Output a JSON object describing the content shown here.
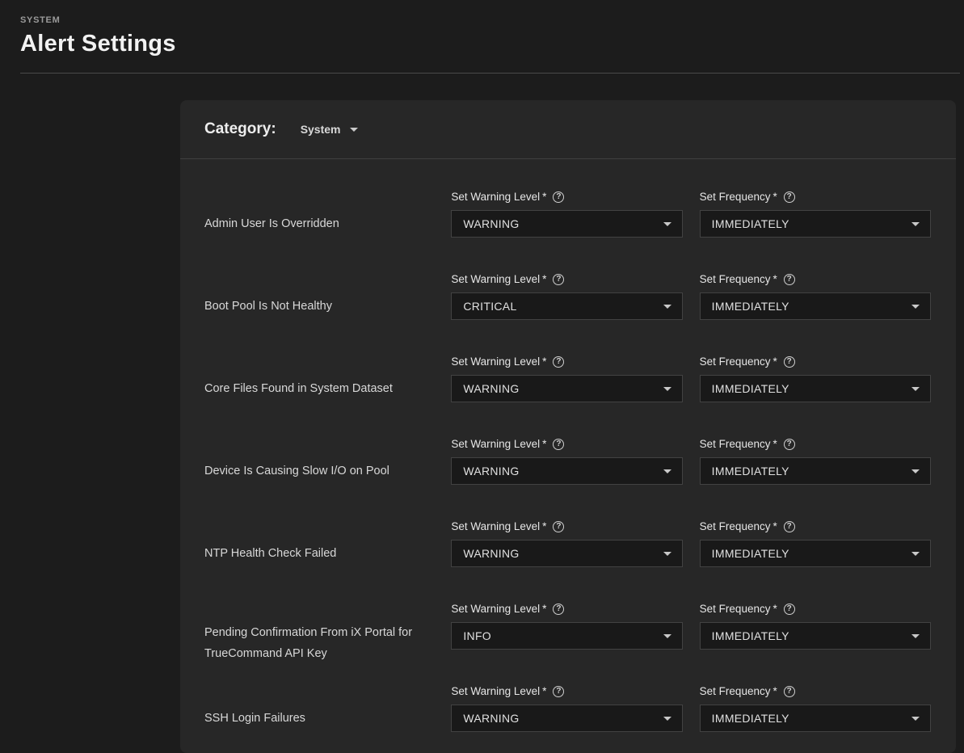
{
  "page": {
    "breadcrumb": "SYSTEM",
    "title": "Alert Settings"
  },
  "card": {
    "category_label": "Category:",
    "category_value": "System"
  },
  "field_labels": {
    "warning": "Set Warning Level",
    "frequency": "Set Frequency",
    "required_marker": "*"
  },
  "rows": [
    {
      "name": "Admin User Is Overridden",
      "warning_level": "WARNING",
      "frequency": "IMMEDIATELY"
    },
    {
      "name": "Boot Pool Is Not Healthy",
      "warning_level": "CRITICAL",
      "frequency": "IMMEDIATELY"
    },
    {
      "name": "Core Files Found in System Dataset",
      "warning_level": "WARNING",
      "frequency": "IMMEDIATELY"
    },
    {
      "name": "Device Is Causing Slow I/O on Pool",
      "warning_level": "WARNING",
      "frequency": "IMMEDIATELY"
    },
    {
      "name": "NTP Health Check Failed",
      "warning_level": "WARNING",
      "frequency": "IMMEDIATELY"
    },
    {
      "name": "Pending Confirmation From iX Portal for TrueCommand API Key",
      "warning_level": "INFO",
      "frequency": "IMMEDIATELY"
    },
    {
      "name": "SSH Login Failures",
      "warning_level": "WARNING",
      "frequency": "IMMEDIATELY"
    }
  ],
  "colors": {
    "page_background": "#1c1c1c",
    "card_background": "#272727",
    "select_background": "#191919",
    "select_border": "#424242",
    "divider": "#4a4a4a",
    "text_primary": "#f2f2f2",
    "text_secondary": "#9a9a9a"
  }
}
